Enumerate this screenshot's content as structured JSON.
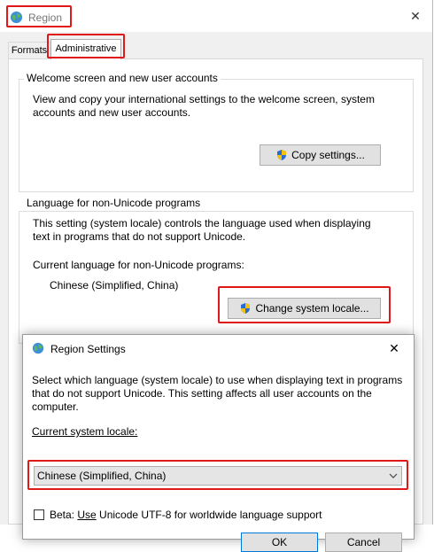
{
  "window": {
    "title": "Region",
    "close_glyph": "✕"
  },
  "tabs": [
    {
      "label": "Formats"
    },
    {
      "label": "Administrative"
    }
  ],
  "welcome": {
    "title": "Welcome screen and new user accounts",
    "desc_line1": "View and copy your international settings to the welcome screen, system",
    "desc_line2": "accounts and new user accounts.",
    "copy_button": "Copy settings..."
  },
  "non_unicode": {
    "title": "Language for non-Unicode programs",
    "desc_line1": "This setting (system locale) controls the language used when displaying",
    "desc_line2": "text in programs that do not support Unicode.",
    "current_label": "Current language for non-Unicode programs:",
    "current_value": "Chinese (Simplified, China)",
    "change_button": "Change system locale..."
  },
  "dialog": {
    "title": "Region Settings",
    "close_glyph": "✕",
    "desc_line1": "Select which language (system locale) to use when displaying text in programs",
    "desc_line2": "that do not support Unicode. This setting affects all user accounts on the",
    "desc_line3": "computer.",
    "locale_label": "Current system locale:",
    "locale_value": "Chinese (Simplified, China)",
    "beta_label_prefix": "Beta: ",
    "beta_label_underlined": "Use",
    "beta_label_rest": " Unicode UTF-8 for worldwide language support",
    "ok_button": "OK",
    "cancel_button": "Cancel"
  },
  "colors": {
    "highlight_red": "#e01818",
    "window_bg": "#f0f0f0",
    "button_bg": "#e1e1e1"
  },
  "icons": [
    "globe-icon",
    "close-icon",
    "shield-icon",
    "chevron-down-icon"
  ]
}
